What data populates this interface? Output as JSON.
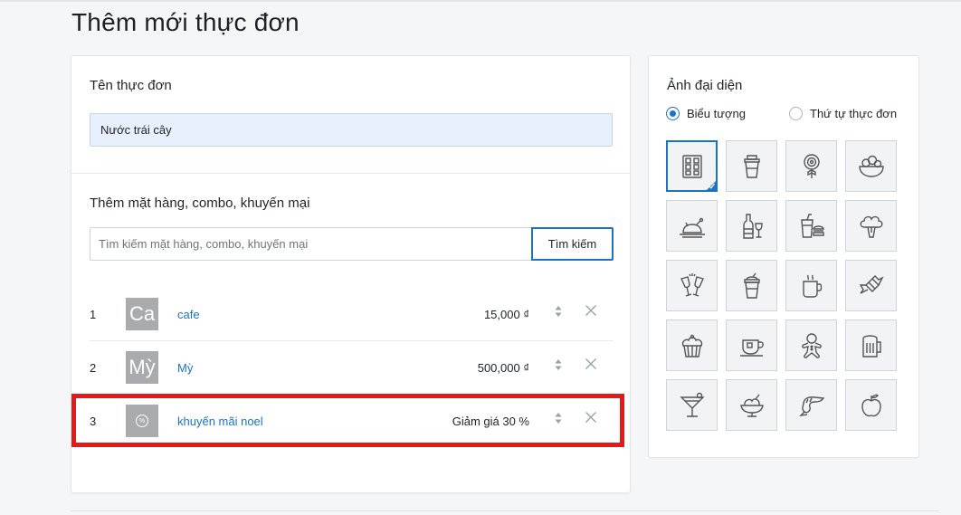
{
  "page": {
    "title": "Thêm mới thực đơn"
  },
  "menu_name": {
    "label": "Tên thực đơn",
    "value": "Nước trái cây"
  },
  "add_items": {
    "label": "Thêm mặt hàng, combo, khuyến mại",
    "search_placeholder": "Tìm kiếm mặt hàng, combo, khuyến mại",
    "search_button": "Tìm kiếm"
  },
  "items": [
    {
      "index": "1",
      "thumb": "Ca",
      "name": "cafe",
      "price": "15,000 ₫"
    },
    {
      "index": "2",
      "thumb": "Mỳ",
      "name": "Mỳ",
      "price": "500,000 ₫"
    },
    {
      "index": "3",
      "thumb": "%",
      "name": "khuyến mãi noel",
      "price": "Giảm giá 30 %"
    }
  ],
  "avatar": {
    "label": "Ảnh đại diện",
    "option_icon": "Biểu tượng",
    "option_order": "Thứ tự thực đơn",
    "selected_option": "Biểu tượng",
    "icons": [
      "menu-grid-icon",
      "cup-icon",
      "lollipop-icon",
      "salad-bowl-icon",
      "roast-chicken-icon",
      "wine-bottle-icon",
      "fast-food-icon",
      "broccoli-icon",
      "champagne-toast-icon",
      "smoothie-icon",
      "coffee-mug-icon",
      "candy-icon",
      "cupcake-icon",
      "teacup-icon",
      "gingerbread-icon",
      "beer-mug-icon",
      "cocktail-icon",
      "ice-cream-icon",
      "shrimp-icon",
      "apple-icon"
    ],
    "selected_icon": "menu-grid-icon"
  },
  "colors": {
    "accent": "#1a73c8",
    "highlight": "#e11b1b",
    "thumb_bg": "#a9abad"
  }
}
